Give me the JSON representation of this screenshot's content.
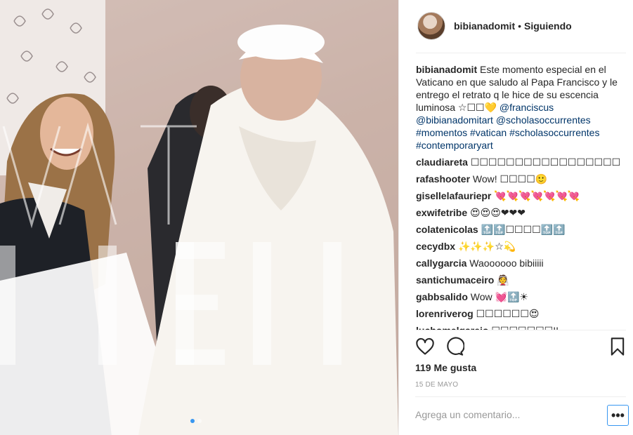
{
  "photo": {
    "watermark_top": "VATICA",
    "watermark_bottom": "MEDIA",
    "carousel": {
      "total": 2,
      "active": 1
    }
  },
  "header": {
    "username": "bibianadomit",
    "separator": "•",
    "follow_status": "Siguiendo"
  },
  "caption": {
    "username": "bibianadomit",
    "text": "Este momento especial en el Vaticano en que saludo al Papa Francisco y le entrego el retrato q le hice de su escencia luminosa ☆☐☐💛",
    "mentions": "@franciscus @bibianadomitart @scholasoccurrentes",
    "hashtags": "#momentos #vatican #scholasoccurrentes #contemporaryart"
  },
  "comments": [
    {
      "user": "claudiareta",
      "text": "☐☐☐☐☐☐☐☐☐☐☐☐☐☐☐☐☐☐"
    },
    {
      "user": "rafashooter",
      "text": "Wow! ☐☐☐☐🙂"
    },
    {
      "user": "gisellelafauriepr",
      "text": "💘💘💘💘💘💘💘"
    },
    {
      "user": "exwifetribe",
      "text": "😍😍😍❤❤❤"
    },
    {
      "user": "colatenicolas",
      "text": "🔝🔝☐☐☐☐🔝🔝"
    },
    {
      "user": "cecydbx",
      "text": "✨✨✨☆💫"
    },
    {
      "user": "callygarcia",
      "text": "Waoooooo bibiiiii"
    },
    {
      "user": "santichumaceiro",
      "text": "👰"
    },
    {
      "user": "gabbsalido",
      "text": "Wow 💓🔝☀"
    },
    {
      "user": "lorenriverog",
      "text": "☐☐☐☐☐☐😍"
    },
    {
      "user": "luchomelgarejo",
      "text": "☐☐☐☐☐☐☐!!"
    }
  ],
  "actions": {
    "like_icon": "heart-icon",
    "comment_icon": "comment-bubble-icon",
    "save_icon": "bookmark-icon"
  },
  "likes": "119 Me gusta",
  "date": "15 DE MAYO",
  "comment_box": {
    "placeholder": "Agrega un comentario...",
    "more_label": "•••"
  },
  "colors": {
    "accent": "#3897f0",
    "text": "#262626",
    "link": "#003569",
    "muted": "#999999"
  }
}
